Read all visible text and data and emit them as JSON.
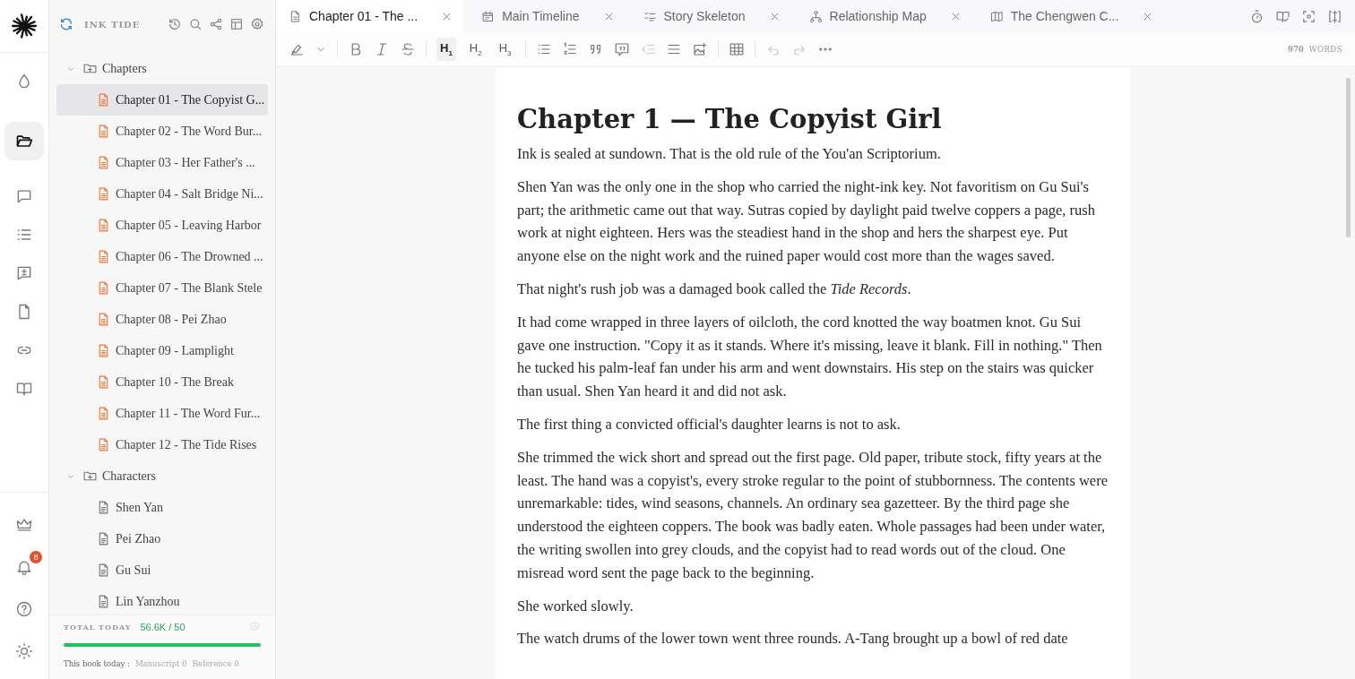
{
  "rail": {
    "items": [
      {
        "selected": false
      },
      {
        "selected": true
      },
      {
        "selected": false
      },
      {
        "selected": false
      },
      {
        "selected": false
      },
      {
        "selected": false
      },
      {
        "selected": false
      },
      {
        "selected": false
      }
    ],
    "bottom": [
      {
        "selected": false
      },
      {
        "selected": false,
        "badge": "8"
      },
      {
        "selected": false
      },
      {
        "selected": false
      }
    ]
  },
  "sidebar": {
    "title": "INK TIDE",
    "tree": [
      {
        "label": "Chapters",
        "kind": "folder",
        "expanded": true,
        "selected": false,
        "children": [
          {
            "label": "Chapter 01 - The Copyist G...",
            "kind": "chapter",
            "selected": true
          },
          {
            "label": "Chapter 02 - The Word Bur...",
            "kind": "chapter",
            "selected": false
          },
          {
            "label": "Chapter 03 - Her Father's ...",
            "kind": "chapter",
            "selected": false
          },
          {
            "label": "Chapter 04 - Salt Bridge Ni...",
            "kind": "chapter",
            "selected": false
          },
          {
            "label": "Chapter 05 - Leaving Harbor",
            "kind": "chapter",
            "selected": false
          },
          {
            "label": "Chapter 06 - The Drowned ...",
            "kind": "chapter",
            "selected": false
          },
          {
            "label": "Chapter 07 - The Blank Stele",
            "kind": "chapter",
            "selected": false
          },
          {
            "label": "Chapter 08 - Pei Zhao",
            "kind": "chapter",
            "selected": false
          },
          {
            "label": "Chapter 09 - Lamplight",
            "kind": "chapter",
            "selected": false
          },
          {
            "label": "Chapter 10 - The Break",
            "kind": "chapter",
            "selected": false
          },
          {
            "label": "Chapter 11 - The Word Fur...",
            "kind": "chapter",
            "selected": false
          },
          {
            "label": "Chapter 12 - The Tide Rises",
            "kind": "chapter",
            "selected": false
          }
        ]
      },
      {
        "label": "Characters",
        "kind": "folder",
        "expanded": true,
        "selected": false,
        "children": [
          {
            "label": "Shen Yan",
            "kind": "note",
            "selected": false
          },
          {
            "label": "Pei Zhao",
            "kind": "note",
            "selected": false
          },
          {
            "label": "Gu Sui",
            "kind": "note",
            "selected": false
          },
          {
            "label": "Lin Yanzhou",
            "kind": "note",
            "selected": false
          }
        ]
      }
    ],
    "footer": {
      "label": "TOTAL TODAY",
      "value": "56.6K / 50",
      "level": 1.0,
      "book_label": "This book today :",
      "manuscript": "Manuscript 0",
      "reference": "Reference 0"
    }
  },
  "tabs": [
    {
      "label": "Chapter 01 - The ...",
      "kind": "doc",
      "selected": true
    },
    {
      "label": "Main Timeline",
      "kind": "timeline",
      "selected": false
    },
    {
      "label": "Story Skeleton",
      "kind": "skeleton",
      "selected": false
    },
    {
      "label": "Relationship Map",
      "kind": "relations",
      "selected": false
    },
    {
      "label": "The Chengwen C...",
      "kind": "map",
      "selected": false
    }
  ],
  "toolbar": [
    {
      "kind": "icon",
      "selected": false,
      "disabled": false
    },
    {
      "kind": "icon",
      "selected": false,
      "disabled": false
    },
    {
      "kind": "separator"
    },
    {
      "kind": "icon",
      "selected": false,
      "disabled": false
    },
    {
      "kind": "icon",
      "selected": false,
      "disabled": false
    },
    {
      "kind": "icon",
      "selected": false,
      "disabled": false
    },
    {
      "kind": "separator"
    },
    {
      "kind": "heading",
      "label": "H$_{1}$",
      "selected": true,
      "disabled": false
    },
    {
      "kind": "heading",
      "label": "H$_{2}$",
      "selected": false,
      "disabled": false
    },
    {
      "kind": "heading",
      "label": "H$_{3}$",
      "selected": false,
      "disabled": false
    },
    {
      "kind": "separator"
    },
    {
      "kind": "icon",
      "selected": false,
      "disabled": false
    },
    {
      "kind": "icon",
      "selected": false,
      "disabled": false
    },
    {
      "kind": "icon",
      "selected": false,
      "disabled": false
    },
    {
      "kind": "icon",
      "selected": false,
      "disabled": false
    },
    {
      "kind": "icon",
      "selected": false,
      "disabled": true
    },
    {
      "kind": "icon",
      "selected": false,
      "disabled": false
    },
    {
      "kind": "icon",
      "selected": false,
      "disabled": false
    },
    {
      "kind": "separator"
    },
    {
      "kind": "icon",
      "selected": false,
      "disabled": false
    },
    {
      "kind": "separator"
    },
    {
      "kind": "icon",
      "selected": false,
      "disabled": true
    },
    {
      "kind": "icon",
      "selected": false,
      "disabled": true
    },
    {
      "kind": "icon",
      "selected": false,
      "disabled": false
    }
  ],
  "word_count": {
    "value": "970",
    "unit": "WORDS"
  },
  "document": {
    "title": "Chapter 1 — The Copyist Girl",
    "paragraphs": [
      "Ink is sealed at sundown. That is the old rule of the You'an Scriptorium.",
      "Shen Yan was the only one in the shop who carried the night-ink key. Not favoritism on Gu Sui's part; the arithmetic came out that way. Sutras copied by daylight paid twelve coppers a page, rush work at night eighteen. Hers was the steadiest hand in the shop and hers the sharpest eye. Put anyone else on the night work and the ruined paper would cost more than the wages saved.",
      "That night's rush job was a damaged book called the *Tide Records*.",
      "It had come wrapped in three layers of oilcloth, the cord knotted the way boatmen knot. Gu Sui gave one instruction. \"Copy it as it stands. Where it's missing, leave it blank. Fill in nothing.\" Then he tucked his palm-leaf fan under his arm and went downstairs. His step on the stairs was quicker than usual. Shen Yan heard it and did not ask.",
      "The first thing a convicted official's daughter learns is not to ask.",
      "She trimmed the wick short and spread out the first page. Old paper, tribute stock, fifty years at the least. The hand was a copyist's, every stroke regular to the point of stubbornness. The contents were unremarkable: tides, wind seasons, channels. An ordinary sea gazetteer. By the third page she understood the eighteen coppers. The book was badly eaten. Whole passages had been under water, the writing swollen into grey clouds, and the copyist had to read words out of the cloud. One misread word sent the page back to the beginning.",
      "She worked slowly.",
      "The watch drums of the lower town went three rounds. A-Tang brought up a bowl of red date"
    ]
  }
}
